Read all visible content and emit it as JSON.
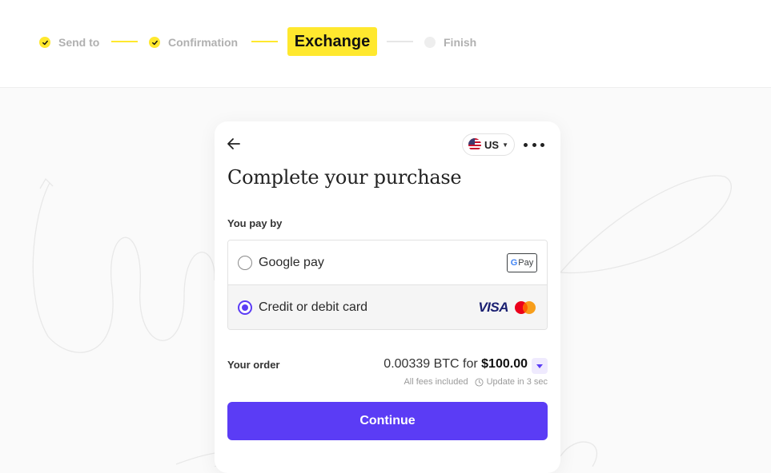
{
  "stepper": {
    "steps": [
      {
        "label": "Send to",
        "status": "done"
      },
      {
        "label": "Confirmation",
        "status": "done"
      },
      {
        "label": "Exchange",
        "status": "active"
      },
      {
        "label": "Finish",
        "status": "pending"
      }
    ],
    "accent": "#ffe82e"
  },
  "card": {
    "locale": {
      "label": "US",
      "flag_icon": "us-flag-icon"
    },
    "title": "Complete your purchase",
    "pay_by_label": "You pay by",
    "payment_options": [
      {
        "label": "Google pay",
        "selected": false,
        "badge": "Pay",
        "icon": "google-pay-icon"
      },
      {
        "label": "Credit or debit card",
        "selected": true,
        "brands": [
          "VISA",
          "mastercard-icon"
        ]
      }
    ],
    "order": {
      "label": "Your order",
      "crypto_amount": "0.00339 BTC for",
      "fiat_amount": "$100.00",
      "fees_note": "All fees included",
      "update_note": "Update in 3 sec"
    },
    "continue_label": "Continue",
    "primary_color": "#5b3cf5"
  }
}
